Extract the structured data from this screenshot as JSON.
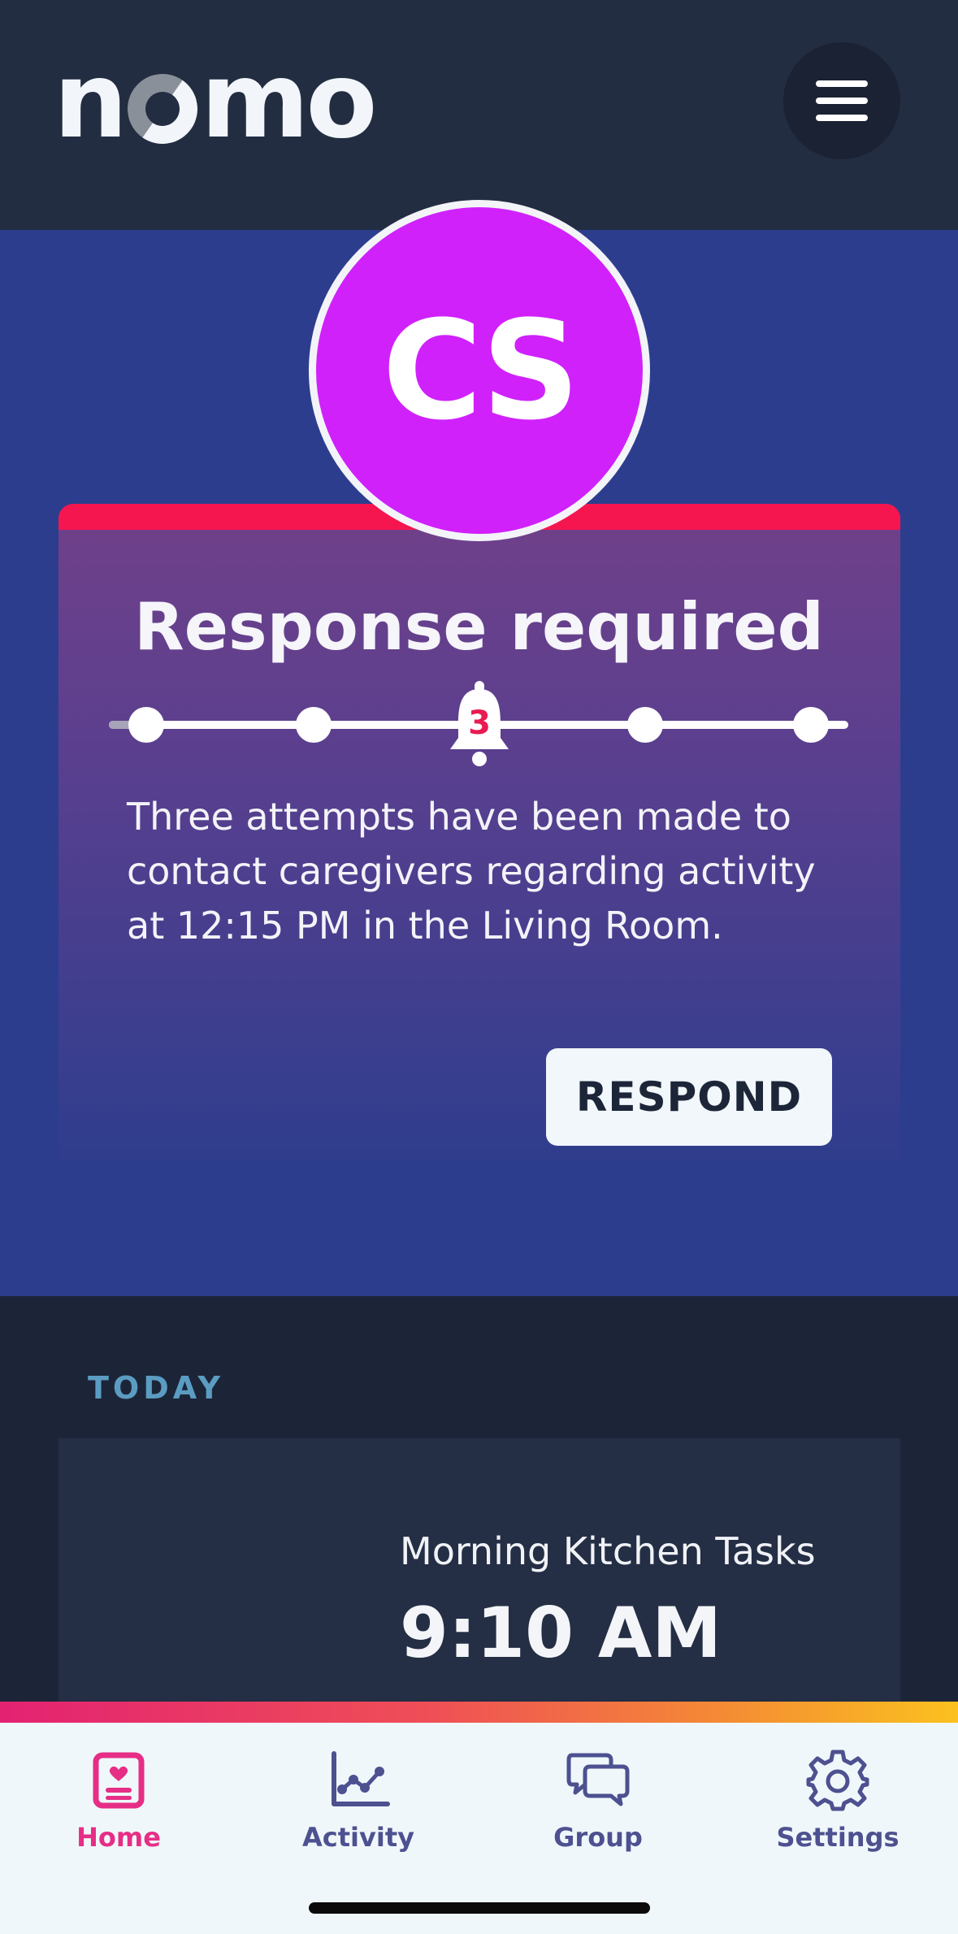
{
  "header": {
    "logo_text": "nomo",
    "menu_icon": "hamburger-menu-icon"
  },
  "alert": {
    "avatar_initials": "CS",
    "avatar_color": "#d021fb",
    "accent_color": "#f5164f",
    "title": "Response required",
    "step_current": "3",
    "steps_total": 5,
    "message": "Three attempts have been made to contact caregivers regarding activity at 12:15 PM in the Living Room.",
    "respond_label": "RESPOND"
  },
  "today": {
    "label": "TODAY",
    "task_name": "Morning Kitchen Tasks",
    "task_time": "9:10 AM"
  },
  "nav": {
    "items": [
      {
        "label": "Home",
        "icon": "home-journal-icon",
        "active": true
      },
      {
        "label": "Activity",
        "icon": "activity-chart-icon",
        "active": false
      },
      {
        "label": "Group",
        "icon": "group-chat-icon",
        "active": false
      },
      {
        "label": "Settings",
        "icon": "gear-icon",
        "active": false
      }
    ],
    "active_color": "#e62e86",
    "inactive_color": "#4d5190"
  }
}
